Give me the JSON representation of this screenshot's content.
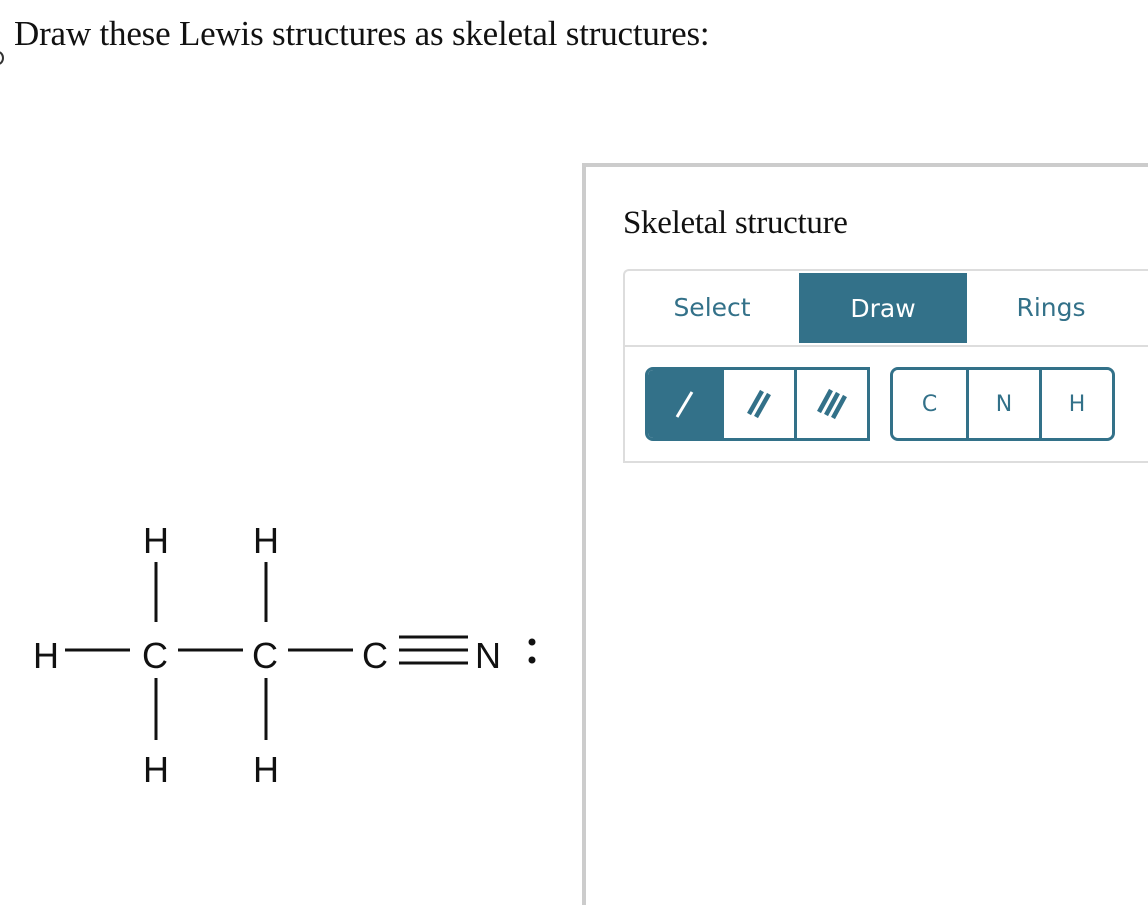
{
  "question": {
    "title": "Draw these Lewis structures as skeletal structures:"
  },
  "lewis_structure": {
    "description": "Propanenitrile Lewis structure (CH3-CH2-C≡N:)",
    "atoms": [
      {
        "id": "h-left",
        "symbol": "H"
      },
      {
        "id": "c1",
        "symbol": "C"
      },
      {
        "id": "c2",
        "symbol": "C"
      },
      {
        "id": "c3",
        "symbol": "C"
      },
      {
        "id": "n",
        "symbol": "N"
      },
      {
        "id": "h-c1-top",
        "symbol": "H"
      },
      {
        "id": "h-c1-bottom",
        "symbol": "H"
      },
      {
        "id": "h-c2-top",
        "symbol": "H"
      },
      {
        "id": "h-c2-bottom",
        "symbol": "H"
      }
    ],
    "bonds": [
      {
        "from": "h-left",
        "to": "c1",
        "order": 1
      },
      {
        "from": "c1",
        "to": "c2",
        "order": 1
      },
      {
        "from": "c2",
        "to": "c3",
        "order": 1
      },
      {
        "from": "c3",
        "to": "n",
        "order": 3
      },
      {
        "from": "c1",
        "to": "h-c1-top",
        "order": 1
      },
      {
        "from": "c1",
        "to": "h-c1-bottom",
        "order": 1
      },
      {
        "from": "c2",
        "to": "h-c2-top",
        "order": 1
      },
      {
        "from": "c2",
        "to": "h-c2-bottom",
        "order": 1
      }
    ],
    "lone_pairs": [
      {
        "atom": "n",
        "label": ":"
      }
    ]
  },
  "answer_panel": {
    "title": "Skeletal structure",
    "mode_tabs": [
      {
        "label": "Select",
        "active": false
      },
      {
        "label": "Draw",
        "active": true
      },
      {
        "label": "Rings",
        "active": false
      }
    ],
    "bond_tools": [
      {
        "name": "single-bond",
        "icon": "single-bond-icon",
        "active": true
      },
      {
        "name": "double-bond",
        "icon": "double-bond-icon",
        "active": false
      },
      {
        "name": "triple-bond",
        "icon": "triple-bond-icon",
        "active": false
      }
    ],
    "atom_tools": [
      {
        "label": "C"
      },
      {
        "label": "N"
      },
      {
        "label": "H"
      }
    ]
  },
  "colors": {
    "accent": "#337189",
    "panel_border": "#cccccc",
    "editor_border": "#dddddd",
    "text": "#111111"
  }
}
